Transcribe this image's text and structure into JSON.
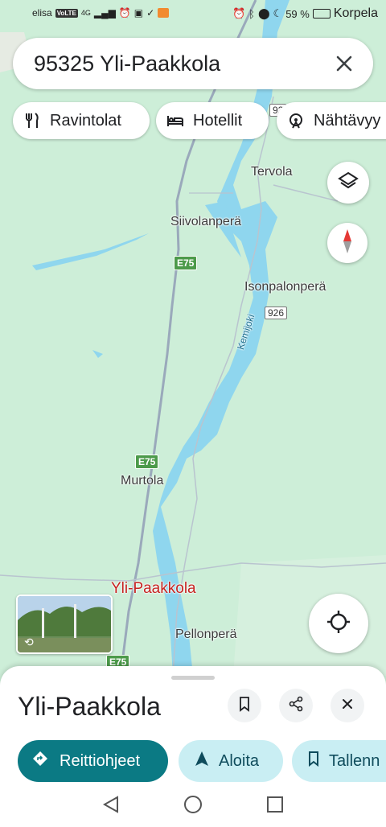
{
  "status_bar": {
    "carrier": "elisa",
    "volte": "VoLTE",
    "network": "4G",
    "battery": "59 %",
    "overlay_place": "Korpela"
  },
  "search": {
    "query": "95325 Yli-Paakkola",
    "clear_icon": "close-icon"
  },
  "chips": [
    {
      "label": "Ravintolat",
      "icon": "restaurant-icon"
    },
    {
      "label": "Hotellit",
      "icon": "hotel-icon"
    },
    {
      "label": "Nähtävyy",
      "icon": "attraction-icon"
    }
  ],
  "map": {
    "labels": {
      "tervola": "Tervola",
      "siivolanpera": "Siivolanperä",
      "isonpalonpera": "Isonpalonperä",
      "kemijoki": "Kemijoki",
      "murtola": "Murtola",
      "yli_paakkola": "Yli-Paakkola",
      "pellonpera": "Pellonperä"
    },
    "shields": {
      "e75": "E75",
      "road926": "926",
      "road92x": "92"
    },
    "colors": {
      "land": "#cdeed8",
      "water": "#8fd6ee",
      "road": "#9aa9bb",
      "selected_label": "#c5221f"
    }
  },
  "sheet": {
    "place_name": "Yli-Paakkola",
    "actions": [
      {
        "label": "Reittiohjeet",
        "style": "primary"
      },
      {
        "label": "Aloita",
        "style": "tonal"
      },
      {
        "label": "Tallenn",
        "style": "tonal"
      }
    ],
    "accent": "#0b7a84"
  }
}
